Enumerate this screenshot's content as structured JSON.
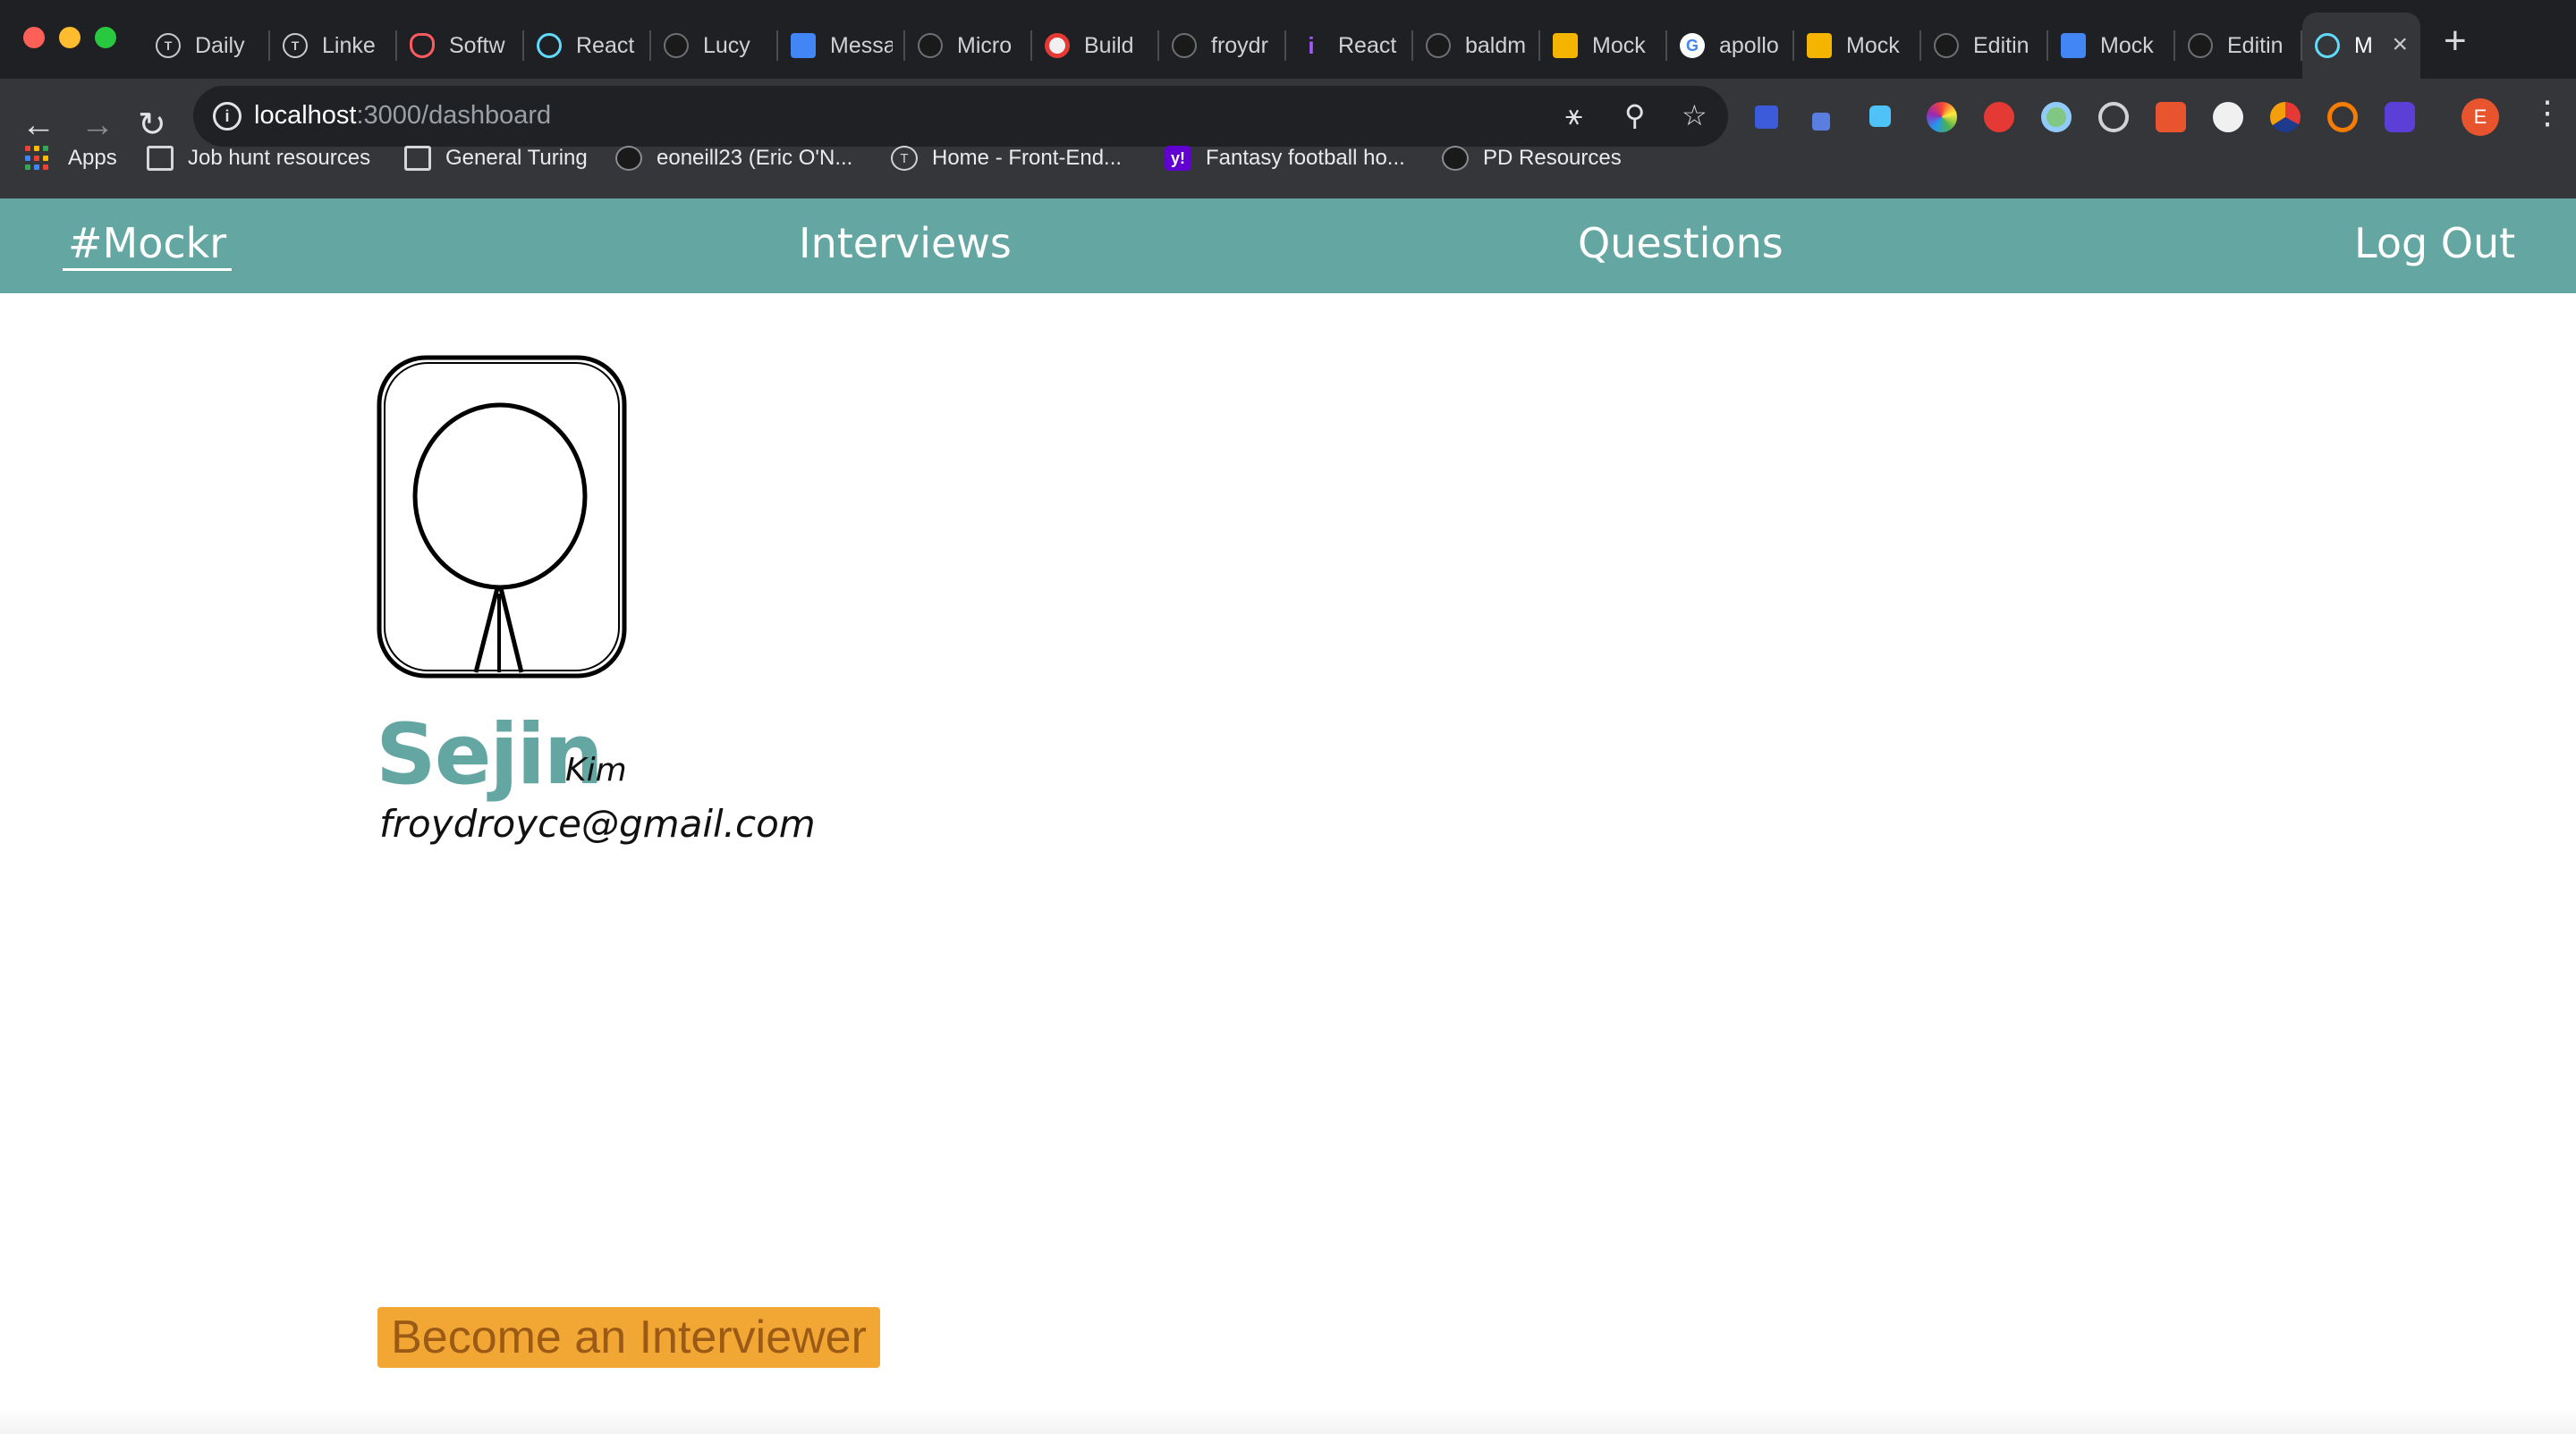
{
  "browser": {
    "tabs": [
      {
        "title": "Daily",
        "icon": "t-circle-icon"
      },
      {
        "title": "Linke",
        "icon": "t-circle-icon"
      },
      {
        "title": "Softw",
        "icon": "airbnb-icon"
      },
      {
        "title": "React",
        "icon": "react-icon"
      },
      {
        "title": "Lucy",
        "icon": "github-icon"
      },
      {
        "title": "Messa",
        "icon": "docs-icon"
      },
      {
        "title": "Micro",
        "icon": "github-icon"
      },
      {
        "title": "Build",
        "icon": "build-icon"
      },
      {
        "title": "froydr",
        "icon": "github-icon"
      },
      {
        "title": "React",
        "icon": "info-icon"
      },
      {
        "title": "baldm",
        "icon": "github-icon"
      },
      {
        "title": "Mock",
        "icon": "slides-icon"
      },
      {
        "title": "apollo",
        "icon": "google-icon"
      },
      {
        "title": "Mock",
        "icon": "slides-icon"
      },
      {
        "title": "Editin",
        "icon": "github-icon"
      },
      {
        "title": "Mock",
        "icon": "docs-icon"
      },
      {
        "title": "Editin",
        "icon": "github-icon"
      }
    ],
    "active_tab": {
      "title": "M",
      "icon": "react-icon"
    },
    "url_host": "localhost",
    "url_path": ":3000/dashboard",
    "profile_initial": "E",
    "bookmarks": [
      {
        "label": "Apps",
        "icon": "apps-grid-icon"
      },
      {
        "label": "Job hunt resources",
        "icon": "folder-icon"
      },
      {
        "label": "General Turing",
        "icon": "folder-icon"
      },
      {
        "label": "eoneill23 (Eric O'N...",
        "icon": "github-icon"
      },
      {
        "label": "Home - Front-End...",
        "icon": "t-circle-icon"
      },
      {
        "label": "Fantasy football ho...",
        "icon": "yahoo-icon"
      },
      {
        "label": "PD Resources",
        "icon": "github-icon"
      }
    ]
  },
  "nav": {
    "brand": "#Mockr",
    "interviews": "Interviews",
    "questions": "Questions",
    "logout": "Log Out"
  },
  "profile": {
    "first_name": "Sejin",
    "last_name": "Kim",
    "email": "froydroyce@gmail.com"
  },
  "actions": {
    "become_interviewer": "Become an Interviewer"
  },
  "colors": {
    "accent": "#63a6a2",
    "button": "#f2a734",
    "button_text": "#9b5a15"
  }
}
